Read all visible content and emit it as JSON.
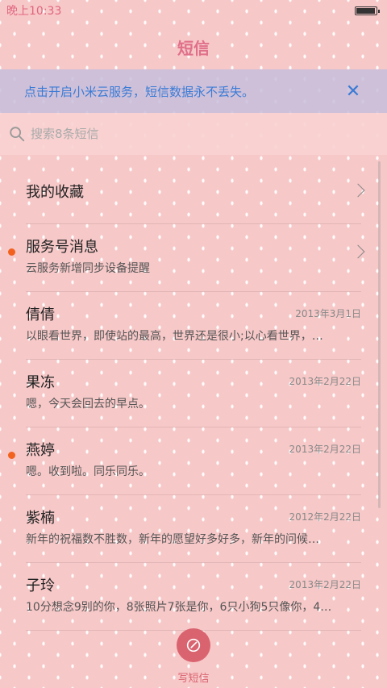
{
  "status_bar": {
    "time": "晚上10:33",
    "battery_level": 0.95
  },
  "header": {
    "title": "短信"
  },
  "banner": {
    "text": "点击开启小米云服务，短信数据永不丢失。",
    "close_icon": "close-icon",
    "accent": "#3a7bd5"
  },
  "search": {
    "placeholder": "搜索8条短信",
    "value": ""
  },
  "list": {
    "favorites": {
      "name": "我的收藏"
    },
    "service": {
      "name": "服务号消息",
      "snippet": "云服务新增同步设备提醒",
      "unread": true
    },
    "threads": [
      {
        "name": "倩倩",
        "date": "2013年3月1日",
        "snippet": "以眼看世界，即使站的最高，世界还是很小;以心看世界，…",
        "unread": false
      },
      {
        "name": "果冻",
        "date": "2013年2月22日",
        "snippet": "嗯，今天会回去的早点。",
        "unread": false
      },
      {
        "name": "燕婷",
        "date": "2013年2月22日",
        "snippet": "嗯。收到啦。同乐同乐。",
        "unread": true
      },
      {
        "name": "紫楠",
        "date": "2012年2月22日",
        "snippet": "新年的祝福数不胜数，新年的愿望好多好多，新年的问候…",
        "unread": false
      },
      {
        "name": "子玲",
        "date": "2013年2月22日",
        "snippet": "10分想念9别的你，8张照片7张是你，6只小狗5只像你，4…",
        "unread": false
      }
    ]
  },
  "compose": {
    "label": "写短信",
    "color": "#d9636f"
  },
  "colors": {
    "background": "#f7c8c8",
    "unread_dot": "#f2611e",
    "title": "#e0708a"
  }
}
